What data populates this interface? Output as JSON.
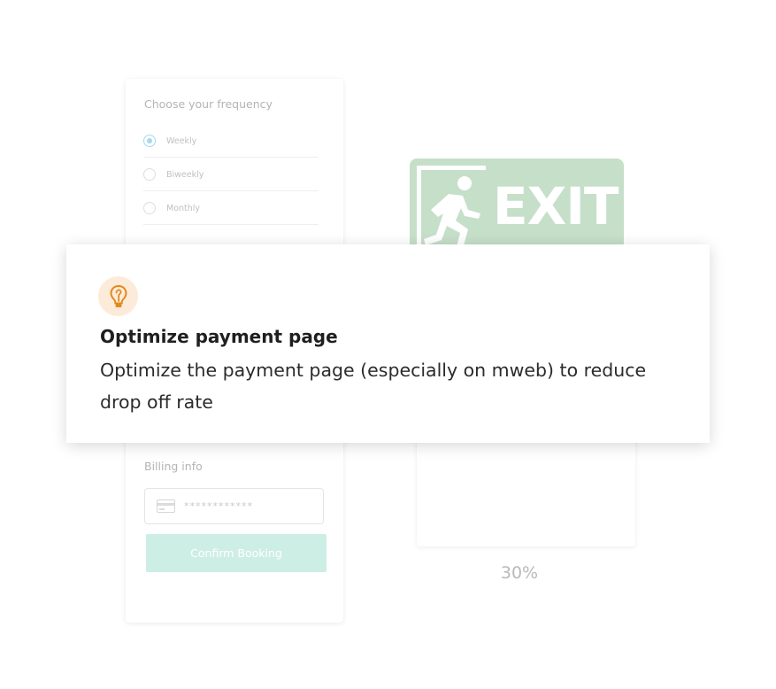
{
  "form": {
    "frequency_title": "Choose your frequency",
    "options": [
      {
        "label": "Weekly",
        "selected": true
      },
      {
        "label": "Biweekly",
        "selected": false
      },
      {
        "label": "Monthly",
        "selected": false
      }
    ],
    "billing_title": "Billing info",
    "card_number_mask": "************",
    "confirm_label": "Confirm Booking"
  },
  "exit_sign": {
    "text": "EXIT",
    "color": "#c6dfc9"
  },
  "stat": {
    "percent": "30%"
  },
  "insight": {
    "icon": "lightbulb-icon",
    "title": "Optimize payment page",
    "description": "Optimize the payment page (especially on mweb) to reduce drop off rate",
    "accent_color": "#e08a1e"
  }
}
